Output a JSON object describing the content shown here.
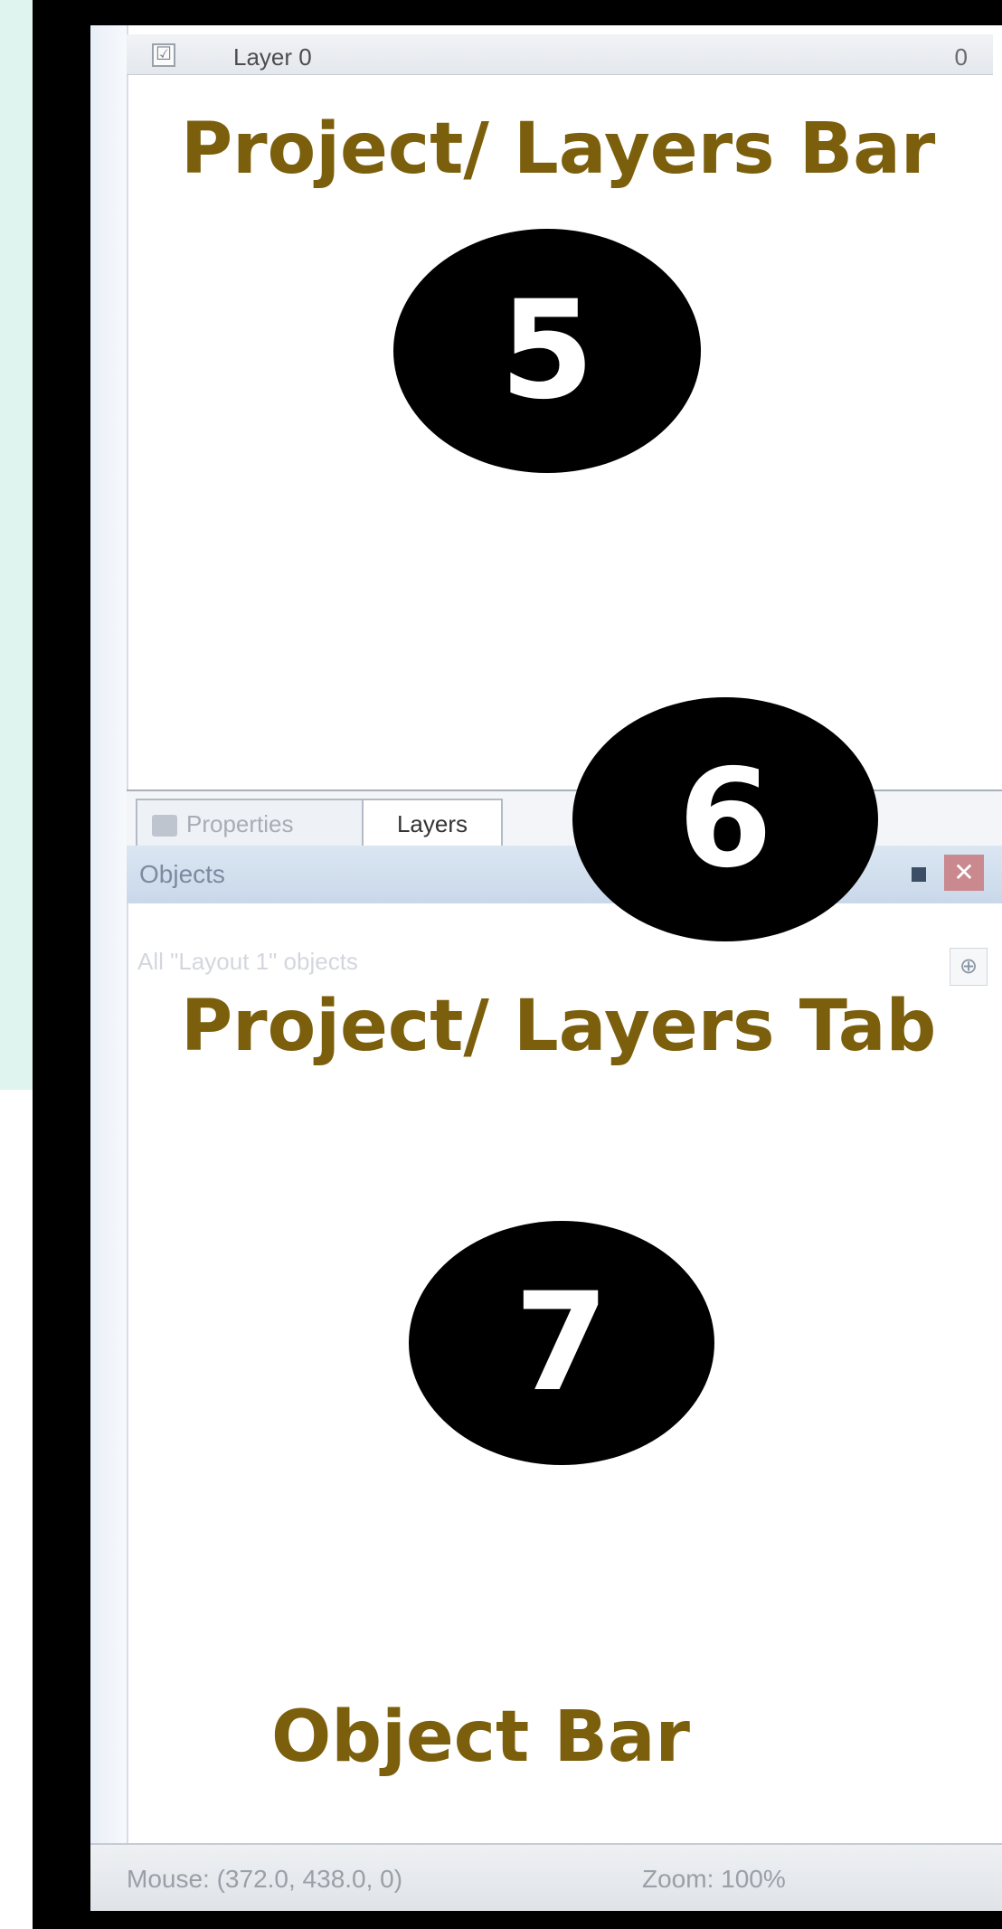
{
  "layers_bar": {
    "checkbox_state": "☑",
    "layer_name": "Layer 0",
    "layer_count": "0"
  },
  "annotations": {
    "project_layers_bar": "Project/ Layers Bar",
    "project_layers_tab": "Project/ Layers Tab",
    "object_bar": "Object Bar"
  },
  "badges": {
    "five": "5",
    "six": "6",
    "seven": "7"
  },
  "tabs": {
    "properties": "Properties",
    "layers": "Layers"
  },
  "objects_panel": {
    "title": "Objects",
    "close_symbol": "✕",
    "pin_symbol": "⊕",
    "info_text": "All \"Layout 1\" objects"
  },
  "status_bar": {
    "mouse": "Mouse: (372.0, 438.0, 0)",
    "zoom": "Zoom: 100%"
  },
  "colors": {
    "annotation_text": "#7c5f0c",
    "badge_fill": "#000000",
    "left_tint": "#dff3ef"
  }
}
